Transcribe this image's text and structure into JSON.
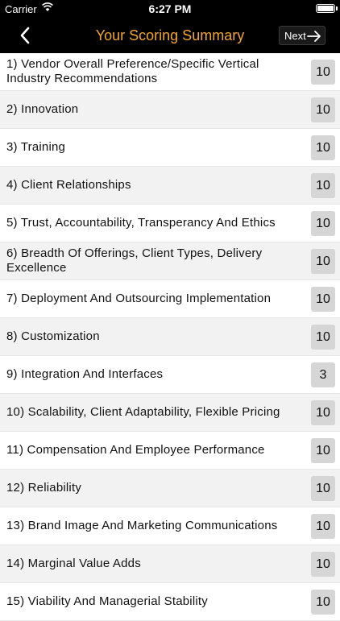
{
  "status_bar": {
    "carrier": "Carrier",
    "time": "6:27 PM",
    "battery_level": 1.0
  },
  "nav": {
    "title": "Your Scoring Summary",
    "next_label": "Next",
    "title_color": "#f4a62a"
  },
  "icons": {
    "back": "chevron-left-icon",
    "next": "arrow-right-icon",
    "wifi": "wifi-icon",
    "battery": "battery-icon"
  },
  "items": [
    {
      "label": "1) Vendor Overall Preference/Specific Vertical Industry Recommendations",
      "score": "10"
    },
    {
      "label": "2) Innovation",
      "score": "10"
    },
    {
      "label": "3) Training",
      "score": "10"
    },
    {
      "label": "4) Client Relationships",
      "score": "10"
    },
    {
      "label": "5) Trust, Accountability, Transperancy And Ethics",
      "score": "10"
    },
    {
      "label": "6) Breadth Of Offerings, Client Types, Delivery Excellence",
      "score": "10"
    },
    {
      "label": "7) Deployment And Outsourcing Implementation",
      "score": "10"
    },
    {
      "label": "8) Customization",
      "score": "10"
    },
    {
      "label": "9) Integration And Interfaces",
      "score": "3"
    },
    {
      "label": "10) Scalability, Client Adaptability, Flexible Pricing",
      "score": "10"
    },
    {
      "label": "11) Compensation And Employee Performance",
      "score": "10"
    },
    {
      "label": "12) Reliability",
      "score": "10"
    },
    {
      "label": "13) Brand Image And Marketing Communications",
      "score": "10"
    },
    {
      "label": "14) Marginal Value Adds",
      "score": "10"
    },
    {
      "label": "15) Viability And Managerial Stability",
      "score": "10"
    }
  ]
}
